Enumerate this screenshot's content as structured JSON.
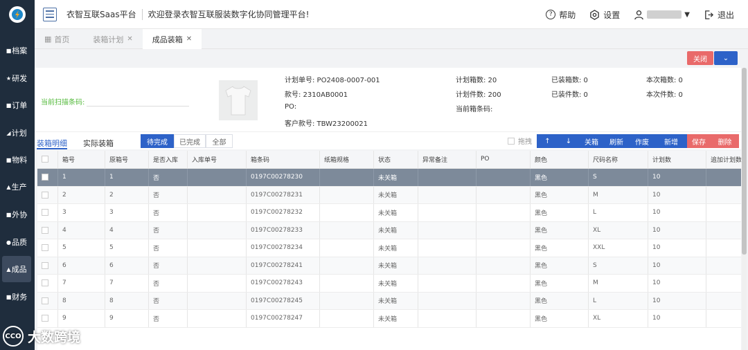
{
  "header": {
    "app_title": "衣智互联Saas平台",
    "welcome": "欢迎登录衣智互联服装数字化协同管理平台!",
    "help": "帮助",
    "settings": "设置",
    "logout": "退出"
  },
  "sidebar": {
    "items": [
      {
        "label": "档案",
        "icon": "■"
      },
      {
        "label": "研发",
        "icon": "★"
      },
      {
        "label": "订单",
        "icon": "■"
      },
      {
        "label": "计划",
        "icon": "◢"
      },
      {
        "label": "物料",
        "icon": "■"
      },
      {
        "label": "生产",
        "icon": "▲"
      },
      {
        "label": "外协",
        "icon": "■"
      },
      {
        "label": "品质",
        "icon": "●"
      },
      {
        "label": "成品",
        "icon": "▲"
      },
      {
        "label": "财务",
        "icon": "■"
      }
    ]
  },
  "tabs": [
    {
      "label": "首页",
      "icon": "▦"
    },
    {
      "label": "装箱计划"
    },
    {
      "label": "成品装箱"
    }
  ],
  "actions": {
    "close": "关闭",
    "dropdown": "⌄"
  },
  "info": {
    "scan_label": "当前扫描条码:",
    "plan_no": "计划单号: PO2408-0007-001",
    "style_no": "款号: 2310AB0001",
    "po": "PO:",
    "customer_style": "客户款号: TBW23200021",
    "plan_boxes": "计划箱数: 20",
    "plan_pieces": "计划件数: 200",
    "current_box": "当前箱条码:",
    "packed_boxes": "已装箱数: 0",
    "packed_pieces": "已装件数: 0",
    "this_boxes": "本次箱数: 0",
    "this_pieces": "本次件数: 0"
  },
  "section": {
    "tab_detail": "装箱明细",
    "tab_actual": "实际装箱",
    "filters": [
      "待完成",
      "已完成",
      "全部"
    ],
    "drag": "拖拽",
    "tools": [
      "↑",
      "↓",
      "关箱",
      "刷新",
      "作废",
      "新增",
      "保存",
      "删除"
    ]
  },
  "colors": {
    "primary": "#2d62c8",
    "danger": "#e96a6a",
    "sidebar": "#1f2d3d",
    "success": "#52b93a"
  },
  "table": {
    "headers": [
      "",
      "箱号",
      "原箱号",
      "是否入库",
      "入库单号",
      "箱条码",
      "纸箱规格",
      "状态",
      "异常备注",
      "PO",
      "颜色",
      "尺码名称",
      "计划数",
      "追加计划数"
    ],
    "rows": [
      [
        "1",
        "1",
        "否",
        "",
        "0197C00278230",
        "",
        "未关箱",
        "",
        "",
        "黑色",
        "S",
        "10"
      ],
      [
        "2",
        "2",
        "否",
        "",
        "0197C00278231",
        "",
        "未关箱",
        "",
        "",
        "黑色",
        "M",
        "10"
      ],
      [
        "3",
        "3",
        "否",
        "",
        "0197C00278232",
        "",
        "未关箱",
        "",
        "",
        "黑色",
        "L",
        "10"
      ],
      [
        "4",
        "4",
        "否",
        "",
        "0197C00278233",
        "",
        "未关箱",
        "",
        "",
        "黑色",
        "XL",
        "10"
      ],
      [
        "5",
        "5",
        "否",
        "",
        "0197C00278234",
        "",
        "未关箱",
        "",
        "",
        "黑色",
        "XXL",
        "10"
      ],
      [
        "6",
        "6",
        "否",
        "",
        "0197C00278241",
        "",
        "未关箱",
        "",
        "",
        "黑色",
        "S",
        "10"
      ],
      [
        "7",
        "7",
        "否",
        "",
        "0197C00278243",
        "",
        "未关箱",
        "",
        "",
        "黑色",
        "M",
        "10"
      ],
      [
        "8",
        "8",
        "否",
        "",
        "0197C00278245",
        "",
        "未关箱",
        "",
        "",
        "黑色",
        "L",
        "10"
      ],
      [
        "9",
        "9",
        "否",
        "",
        "0197C00278247",
        "",
        "未关箱",
        "",
        "",
        "黑色",
        "XL",
        "10"
      ]
    ]
  },
  "watermark": {
    "badge": "CCO",
    "text": "大数跨境"
  }
}
